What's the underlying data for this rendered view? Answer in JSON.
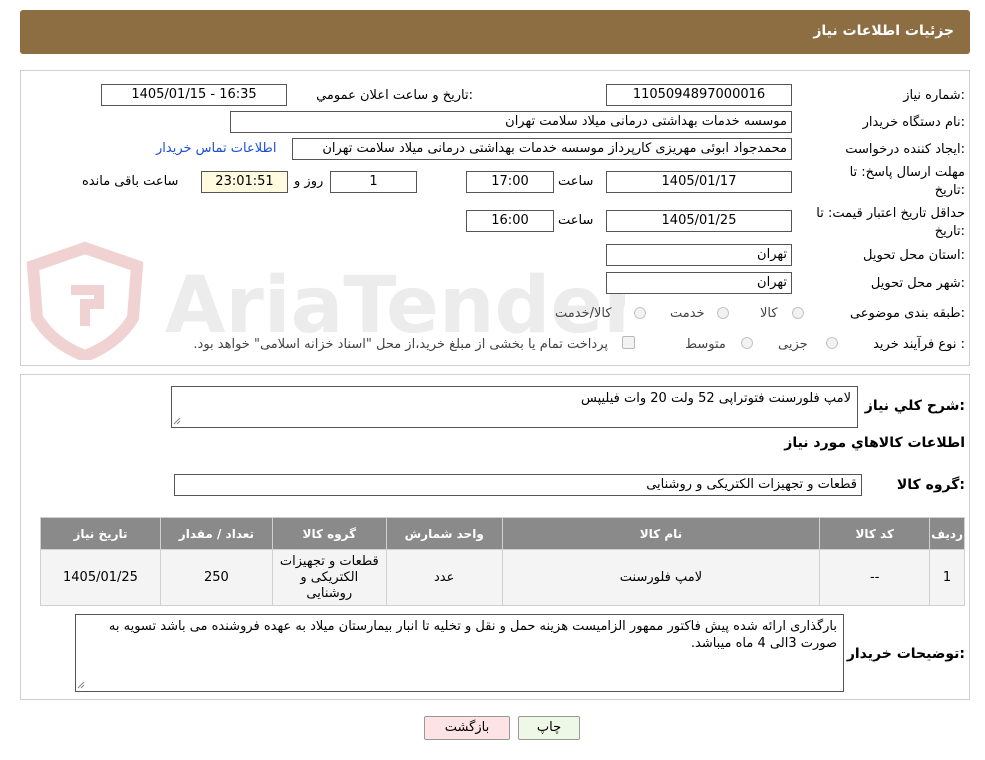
{
  "header": {
    "title": "جزئیات اطلاعات نیاز"
  },
  "watermark": {
    "text": "AriaTender.neT"
  },
  "fields": {
    "need_number_label": "شماره نیاز:",
    "need_number": "1105094897000016",
    "announce_label": "تاریخ و ساعت اعلان عمومي:",
    "announce_value": "1405/01/15 - 16:35",
    "buyer_org_label": "نام دستگاه خریدار:",
    "buyer_org": "موسسه خدمات بهداشتی درمانی میلاد سلامت تهران",
    "creator_label": "ایجاد کننده درخواست:",
    "creator": "محمدجواد ابوئی مهریزی کارپرداز موسسه خدمات بهداشتی درمانی میلاد سلامت تهران",
    "contact_link": "اطلاعات تماس خریدار",
    "deadline_label_1": "مهلت ارسال پاسخ: تا",
    "deadline_label_2": "تاریخ:",
    "deadline_date": "1405/01/17",
    "time_label": "ساعت",
    "deadline_time": "17:00",
    "days_value": "1",
    "days_label": "روز و",
    "remaining_time": "23:01:51",
    "remaining_label": "ساعت باقی مانده",
    "validity_label_1": "حداقل تاریخ اعتبار قیمت: تا",
    "validity_label_2": "تاریخ:",
    "validity_date": "1405/01/25",
    "validity_time_label": "ساعت",
    "validity_time": "16:00",
    "province_label": "استان محل تحویل:",
    "province": "تهران",
    "city_label": "شهر محل تحویل:",
    "city": "تهران",
    "category_label": "طبقه بندی موضوعی:",
    "category_options": [
      "کالا",
      "خدمت",
      "کالا/خدمت"
    ],
    "process_label": "نوع فرآیند خرید :",
    "process_options": [
      "جزیی",
      "متوسط"
    ],
    "payment_note": "پرداخت تمام یا بخشی از مبلغ خرید،از محل \"اسناد خزانه اسلامی\" خواهد بود."
  },
  "summary": {
    "label": "شرح کلي نیاز:",
    "value": "لامپ فلورسنت فتوتراپی 52 ولت 20 وات فیلیپس",
    "items_title": "اطلاعات کالاهاي مورد نیاز",
    "group_label": "گروه کالا:",
    "group_value": "قطعات و تجهیزات الکتریکی و روشنایی"
  },
  "table": {
    "headers": [
      "ردیف",
      "کد کالا",
      "نام کالا",
      "واحد شمارش",
      "گروه کالا",
      "تعداد / مقدار",
      "تاریخ نیاز"
    ],
    "rows": [
      [
        "1",
        "--",
        "لامپ فلورسنت",
        "عدد",
        "قطعات و تجهیزات الکتریکی و روشنایی",
        "250",
        "1405/01/25"
      ]
    ]
  },
  "notes": {
    "label": "توضیحات خریدار:",
    "text": "بارگذاری ارائه شده پیش فاکتور ممهور الزامیست هزینه حمل و نقل و تخلیه تا انبار بیمارستان میلاد به عهده فروشنده می باشد تسویه به صورت 3الی 4 ماه میباشد."
  },
  "buttons": {
    "print": "چاپ",
    "back": "بازگشت"
  },
  "colors": {
    "header_bg": "#8d6e43",
    "link": "#1a4fd6",
    "table_header": "#8a8a8a",
    "back_button": "#fde3e3",
    "print_button": "#eef8e6"
  }
}
